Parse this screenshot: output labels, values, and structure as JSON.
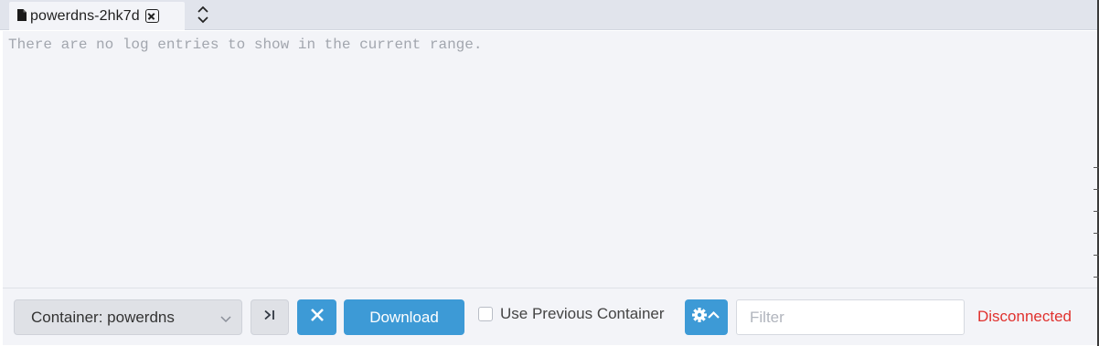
{
  "tab": {
    "label": "powerdns-2hk7d",
    "icon": "file-icon",
    "close_icon": "close-icon"
  },
  "tabbar": {
    "expand_icon": "chevron-up-down-icon"
  },
  "log": {
    "empty_message": "There are no log entries to show in the current range."
  },
  "footer": {
    "container_select": "Container: powerdns",
    "tail_icon": "skip-to-end-icon",
    "clear_icon": "close-icon",
    "download_label": "Download",
    "use_previous_label": "Use Previous Container",
    "use_previous_checked": false,
    "settings_icon": "gear-chevron-up-icon",
    "filter_placeholder": "Filter",
    "filter_value": "",
    "status": "Disconnected"
  },
  "colors": {
    "accent": "#3d9ad6",
    "status_error": "#e0312e",
    "tabbar_bg": "#e1e4ec",
    "panel_bg": "#f3f4f8"
  }
}
